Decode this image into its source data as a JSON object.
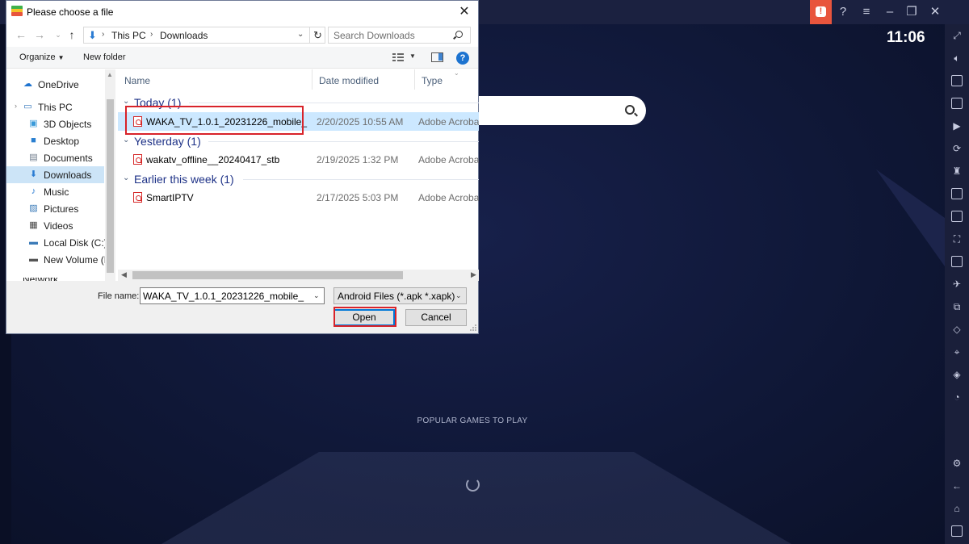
{
  "bluestacks": {
    "clock": "11:06",
    "popular_label": "POPULAR GAMES TO PLAY",
    "search_icon": "search-icon",
    "sidebar_icons": [
      "expand-icon",
      "volume-icon",
      "video-icon",
      "keyboard-icon",
      "macro-icon",
      "rotate-icon",
      "controller-icon",
      "apk-icon",
      "screenshot-icon",
      "resize-icon",
      "media-folder-icon",
      "airplane-icon",
      "multi-instance-icon",
      "eco-mode-icon",
      "location-icon",
      "layers-icon",
      "sync-icon",
      "settings-icon",
      "back-icon",
      "home-icon",
      "recent-apps-icon"
    ],
    "window_controls": [
      "alert-icon",
      "help-icon",
      "menu-icon",
      "minimize-icon",
      "restore-icon",
      "close-icon"
    ],
    "accent_color": "#e8553d"
  },
  "dialog": {
    "title": "Please choose a file",
    "address": {
      "crumb1": "This PC",
      "crumb2": "Downloads"
    },
    "search_placeholder": "Search Downloads",
    "toolbar": {
      "organize": "Organize",
      "new_folder": "New folder"
    },
    "nav_items": [
      {
        "label": "OneDrive",
        "icon": "cloud-icon"
      },
      {
        "label": "This PC",
        "icon": "computer-icon"
      },
      {
        "label": "3D Objects",
        "icon": "cube-icon"
      },
      {
        "label": "Desktop",
        "icon": "desktop-icon"
      },
      {
        "label": "Documents",
        "icon": "document-icon"
      },
      {
        "label": "Downloads",
        "icon": "download-icon"
      },
      {
        "label": "Music",
        "icon": "music-icon"
      },
      {
        "label": "Pictures",
        "icon": "picture-icon"
      },
      {
        "label": "Videos",
        "icon": "video-icon"
      },
      {
        "label": "Local Disk (C:)",
        "icon": "disk-icon"
      },
      {
        "label": "New Volume (F",
        "icon": "drive-icon"
      }
    ],
    "nav_peek": "Network",
    "columns": {
      "name": "Name",
      "date": "Date modified",
      "type": "Type"
    },
    "groups": [
      {
        "title": "Today (1)",
        "files": [
          {
            "name": "WAKA_TV_1.0.1_20231226_mobile_",
            "date": "2/20/2025 10:55 AM",
            "type": "Adobe Acrobat"
          }
        ]
      },
      {
        "title": "Yesterday (1)",
        "files": [
          {
            "name": "wakatv_offline__20240417_stb",
            "date": "2/19/2025 1:32 PM",
            "type": "Adobe Acrobat"
          }
        ]
      },
      {
        "title": "Earlier this week (1)",
        "files": [
          {
            "name": "SmartIPTV",
            "date": "2/17/2025 5:03 PM",
            "type": "Adobe Acrobat"
          }
        ]
      }
    ],
    "file_name_label": "File name:",
    "file_name_value": "WAKA_TV_1.0.1_20231226_mobile_",
    "filter_value": "Android Files (*.apk *.xapk)",
    "open_label": "Open",
    "cancel_label": "Cancel",
    "highlight_color": "#d8232a"
  }
}
